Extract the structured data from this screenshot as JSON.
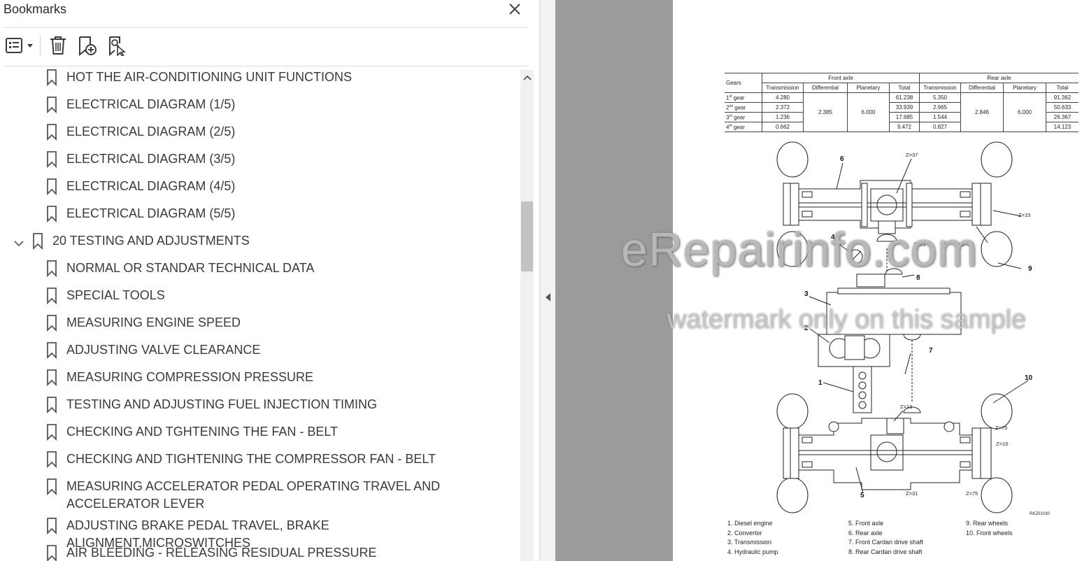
{
  "panel": {
    "title": "Bookmarks",
    "toolbar": {
      "options_icon": "list-options-icon",
      "delete_icon": "trash-icon",
      "new_bookmark_icon": "new-bookmark-icon",
      "find_bookmark_icon": "find-current-bookmark-icon"
    },
    "items": [
      {
        "label": "HOT THE AIR-CONDITIONING UNIT FUNCTIONS",
        "level": 2
      },
      {
        "label": "ELECTRICAL DIAGRAM (1/5)",
        "level": 2
      },
      {
        "label": "ELECTRICAL DIAGRAM (2/5)",
        "level": 2
      },
      {
        "label": "ELECTRICAL DIAGRAM (3/5)",
        "level": 2
      },
      {
        "label": "ELECTRICAL DIAGRAM (4/5)",
        "level": 2
      },
      {
        "label": "ELECTRICAL DIAGRAM (5/5)",
        "level": 2
      },
      {
        "label": "20 TESTING AND ADJUSTMENTS",
        "level": 1,
        "expanded": true
      },
      {
        "label": "NORMAL OR STANDAR TECHNICAL DATA",
        "level": 2
      },
      {
        "label": "SPECIAL TOOLS",
        "level": 2
      },
      {
        "label": "MEASURING ENGINE SPEED",
        "level": 2
      },
      {
        "label": "ADJUSTING VALVE CLEARANCE",
        "level": 2
      },
      {
        "label": "MEASURING COMPRESSION PRESSURE",
        "level": 2
      },
      {
        "label": "TESTING AND ADJUSTING FUEL INJECTION TIMING",
        "level": 2
      },
      {
        "label": "CHECKING AND TGHTENING THE FAN - BELT",
        "level": 2
      },
      {
        "label": "CHECKING AND TIGHTENING THE COMPRESSOR FAN - BELT",
        "level": 2
      },
      {
        "label": "MEASURING ACCELERATOR PEDAL OPERATING TRAVEL AND ACCELERATOR LEVER",
        "level": 2
      },
      {
        "label": "ADJUSTING BRAKE PEDAL TRAVEL, BRAKE ALIGNMENT,MICROSWITCHES",
        "level": 2
      },
      {
        "label": "AIR BLEEDING - RELEASING RESIDUAL PRESSURE",
        "level": 2
      }
    ]
  },
  "document": {
    "gear_table": {
      "group_headers": [
        "Gears",
        "Front axle",
        "Rear axle"
      ],
      "sub_headers": [
        "Transmission",
        "Differential",
        "Planetary",
        "Total",
        "Transmission",
        "Differential",
        "Planetary",
        "Total"
      ],
      "rows": [
        {
          "gear": "1",
          "sup": "st",
          "suffix": " gear",
          "ft": "4.280",
          "ftot": "61.238",
          "rt": "5.350",
          "rtot": "91.362"
        },
        {
          "gear": "2",
          "sup": "nd",
          "suffix": " gear",
          "ft": "2.372",
          "ftot": "33.939",
          "rt": "2.965",
          "rtot": "50.633"
        },
        {
          "gear": "3",
          "sup": "rd",
          "suffix": " gear",
          "ft": "1.236",
          "ftot": "17.685",
          "rt": "1.544",
          "rtot": "26.367"
        },
        {
          "gear": "4",
          "sup": "th",
          "suffix": " gear",
          "ft": "0.662",
          "ftot": "9.472",
          "rt": "0.827",
          "rtot": "14.123"
        }
      ],
      "front_differential": "2.385",
      "front_planetary": "6.000",
      "rear_differential": "2.846",
      "rear_planetary": "6.000"
    },
    "diagram_labels": {
      "n1": "1",
      "n2": "2",
      "n3": "3",
      "n4": "4",
      "n5": "5",
      "n6": "6",
      "n7": "7",
      "n8": "8",
      "n9": "9",
      "n10": "10",
      "z37": "Z=37",
      "z15a": "Z=15",
      "z13a": "Z=13",
      "z75a": "Z=75",
      "z13b": "Z=13",
      "z75b": "Z=75",
      "z15b": "Z=15",
      "z31": "Z=31",
      "z75c": "Z=75",
      "figure_code": "RKZ01030"
    },
    "legend": [
      [
        "1.  Diesel engine",
        "2.  Convertor",
        "3.  Transmission",
        "4.  Hydraulic pump"
      ],
      [
        "5.  Front axle",
        "6.  Rear axle",
        "7.  Front Cardan drive shaft",
        "8.  Rear Cardan drive shaft"
      ],
      [
        "9.  Rear wheels",
        "10.  Front wheels"
      ]
    ],
    "watermark_main": "eRepairinfo.com",
    "watermark_sub": "watermark only on this sample"
  }
}
